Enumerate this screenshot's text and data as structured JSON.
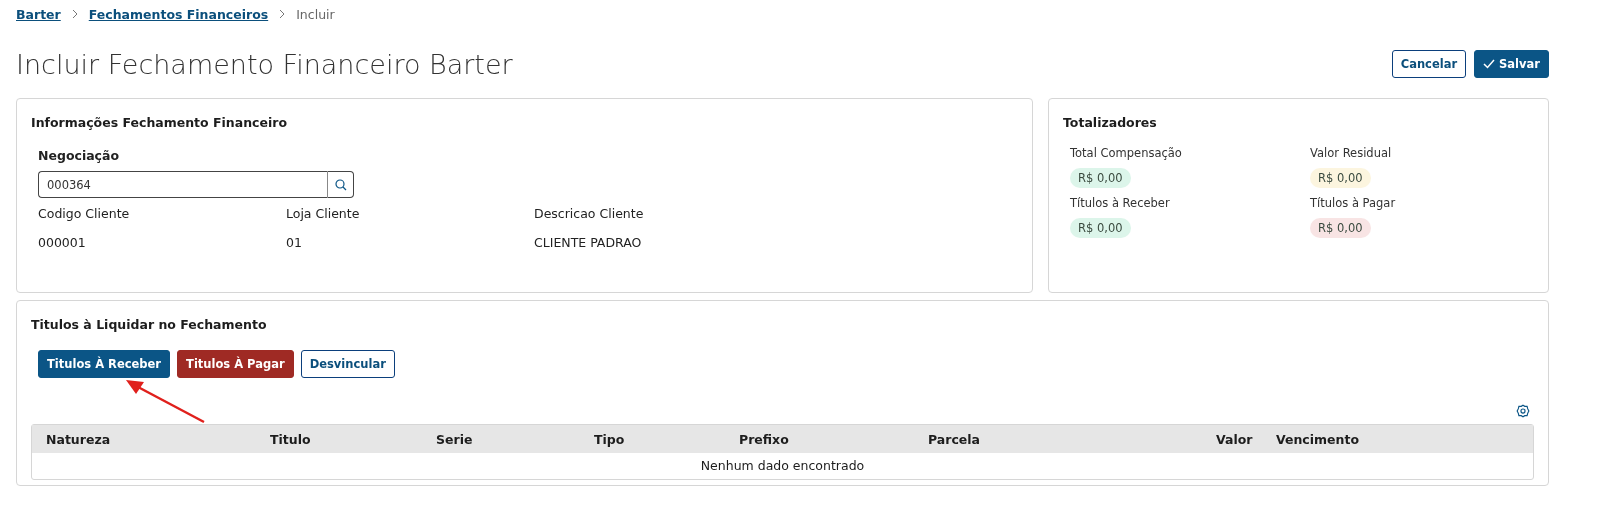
{
  "breadcrumb": [
    {
      "label": "Barter",
      "kind": "link"
    },
    {
      "label": "Fechamentos Financeiros",
      "kind": "link"
    },
    {
      "label": "Incluir",
      "kind": "current"
    }
  ],
  "title": "Incluir Fechamento Financeiro Barter",
  "actions": [
    {
      "label": "Cancelar",
      "kind": "outline"
    },
    {
      "label": "Salvar",
      "kind": "primary"
    }
  ],
  "info": {
    "title": "Informações Fechamento Financeiro",
    "field_label": "Negociação",
    "field_value": "000364",
    "fields": [
      {
        "label": "Codigo Cliente",
        "value": "000001"
      },
      {
        "label": "Loja Cliente",
        "value": "01"
      },
      {
        "label": "Descricao Cliente",
        "value": "CLIENTE PADRAO"
      }
    ]
  },
  "totals": {
    "title": "Totalizadores",
    "items": [
      {
        "label": "Total Compensação",
        "value": "R$ 0,00",
        "color": "#dcf5ea"
      },
      {
        "label": "Valor Residual",
        "value": "R$ 0,00",
        "color": "#fcf5df"
      },
      {
        "label": "Títulos à Receber",
        "value": "R$ 0,00",
        "color": "#dcf5ea"
      },
      {
        "label": "Títulos à Pagar",
        "value": "R$ 0,00",
        "color": "#f8e4e4"
      }
    ]
  },
  "titles": {
    "title": "Titulos à Liquidar no Fechamento",
    "buttons": [
      {
        "label": "Titulos À Receber",
        "kind": "primary"
      },
      {
        "label": "Titulos À Pagar",
        "kind": "danger"
      },
      {
        "label": "Desvincular",
        "kind": "outline"
      }
    ],
    "table": {
      "columns": [
        "Natureza",
        "Titulo",
        "Serie",
        "Tipo",
        "Prefixo",
        "Parcela",
        "Valor",
        "Vencimento"
      ],
      "empty": "Nenhum dado encontrado"
    }
  }
}
